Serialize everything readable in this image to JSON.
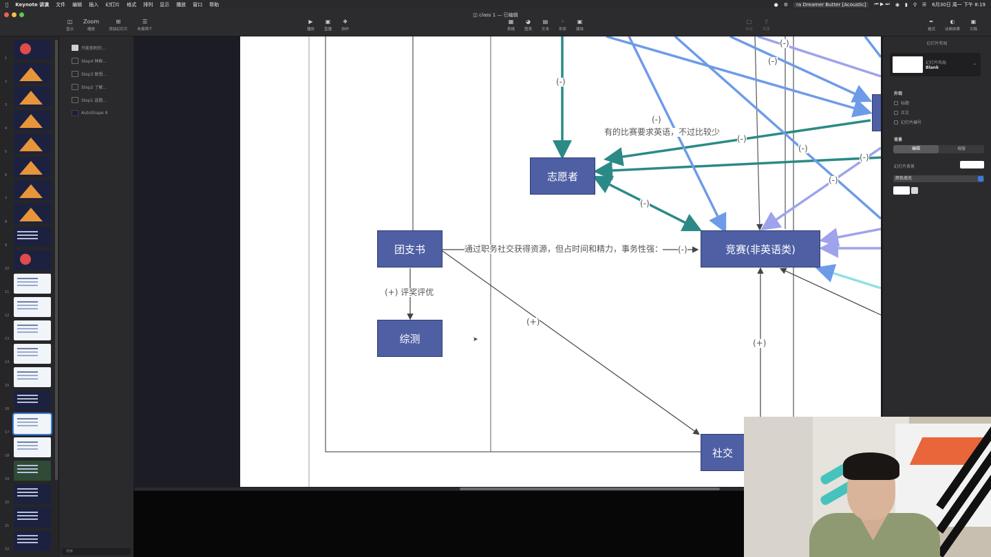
{
  "menubar": {
    "app_name": "Keynote 讲演",
    "items": [
      "文件",
      "编辑",
      "插入",
      "幻灯片",
      "格式",
      "排列",
      "显示",
      "播放",
      "窗口",
      "帮助"
    ],
    "now_playing": "ra Dreamer Butter [Acoustic]",
    "date_time": "6月30日 周一 下午 8:19"
  },
  "window": {
    "title": "class 1",
    "title_suffix": "— 已编辑",
    "toolbar_left": [
      "显示",
      "缩放",
      "添加幻灯片",
      "布局两个"
    ],
    "zoom_value": "Zoom",
    "toolbar_center": [
      "播放",
      "直播",
      "协作"
    ],
    "toolbar_insert": [
      "表格",
      "图表",
      "文本",
      "形状",
      "媒体"
    ],
    "toolbar_mid_right": [
      "评论",
      "共享"
    ],
    "toolbar_right": [
      "格式",
      "动画效果",
      "文稿"
    ]
  },
  "navigator": {
    "slide_numbers": [
      "1",
      "2",
      "3",
      "4",
      "5",
      "6",
      "7",
      "8",
      "9",
      "10",
      "11",
      "12",
      "13",
      "14",
      "15",
      "16",
      "17",
      "18",
      "19",
      "20",
      "21",
      "22"
    ],
    "selected_slide": "17"
  },
  "object_list": {
    "items": [
      "只能依附的...",
      "Step4 种群...",
      "Step3 联想...",
      "Step2 了解...",
      "Step1 选题...",
      "AutoShape 9"
    ],
    "search_placeholder": "搜索"
  },
  "diagram": {
    "nodes": {
      "volunteer": "志愿者",
      "youth_league_secretary": "团支书",
      "assessment": "综测",
      "competition": "竞赛(非英语类)",
      "social": "社交"
    },
    "edge_labels": {
      "minus_a": "(-)",
      "minus_b": "(-)",
      "minus_c": "(-)",
      "minus_d": "(-)",
      "minus_e": "(-)",
      "minus_f": "(-)",
      "minus_g": "(-)",
      "minus_h": "(-)",
      "minus_i": "(-)",
      "plus_award": "(+) 评奖评优",
      "plus_diag": "(+)",
      "plus_vert": "(+)",
      "english_note": "有的比赛要求英语，不过比较少",
      "secretary_note": "通过职务社交获得资源，但占时间和精力，事务性强：",
      "secretary_minus": "(-)"
    }
  },
  "inspector": {
    "title": "幻灯片布局",
    "layout_label": "幻灯片布局",
    "layout_value": "Blank",
    "appearance_heading": "外观",
    "checkboxes": [
      "标题",
      "正文",
      "幻灯片编号"
    ],
    "background_heading": "背景",
    "segments": [
      "编辑",
      "母版"
    ],
    "fill_label": "幻灯片背景",
    "fill_dropdown": "颜色填充"
  },
  "colors": {
    "node_fill": "#4f5fa4",
    "teal_arrow": "#2b8a86",
    "blue_arrow": "#6d9be8",
    "lavender_arrow": "#9ea3ec",
    "cyan_arrow": "#8fe0e4"
  }
}
